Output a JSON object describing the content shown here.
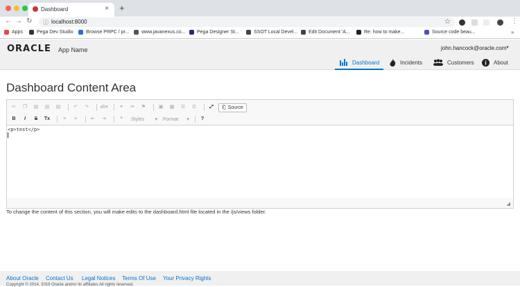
{
  "browser": {
    "tab_title": "Dashboard",
    "url": "localhost:8000",
    "bookmarks": [
      {
        "label": "Apps",
        "color": "#e44"
      },
      {
        "label": "Pega Dev Studio",
        "color": "#333"
      },
      {
        "label": "Browse PRPC / pr...",
        "color": "#2a6ed1"
      },
      {
        "label": "www.javanexus.co...",
        "color": "#555"
      },
      {
        "label": "Pega Designer St...",
        "color": "#2a2a6e"
      },
      {
        "label": "SSOT Local Devel...",
        "color": "#444"
      },
      {
        "label": "Edit Document 'A...",
        "color": "#444"
      },
      {
        "label": "Re: how to make...",
        "color": "#222"
      },
      {
        "label": "Source code beau...",
        "color": "#4a55b3"
      }
    ]
  },
  "app": {
    "logo": "ORACLE",
    "name": "App Name",
    "user": "john.hancock@oracle.com",
    "nav": [
      {
        "label": "Dashboard",
        "icon": "bar-chart-icon",
        "active": true
      },
      {
        "label": "Incidents",
        "icon": "fire-icon",
        "active": false
      },
      {
        "label": "Customers",
        "icon": "people-icon",
        "active": false
      },
      {
        "label": "About",
        "icon": "info-icon",
        "active": false
      }
    ],
    "accent_color": "#0572ce"
  },
  "content": {
    "title": "Dashboard Content Area",
    "editor": {
      "source_button": "Source",
      "styles_placeholder": "Styles",
      "format_placeholder": "Format",
      "body": "<p>test</p>"
    },
    "help_text": "To change the content of this section, you will make edits to the dashboard.html file located in the /js/views folder."
  },
  "footer": {
    "links": [
      "About Oracle",
      "Contact Us",
      "Legal Notices",
      "Terms Of Use",
      "Your Privacy Rights"
    ],
    "copyright": "Copyright © 2014, 2019 Oracle and/or its affiliates All rights reserved."
  }
}
